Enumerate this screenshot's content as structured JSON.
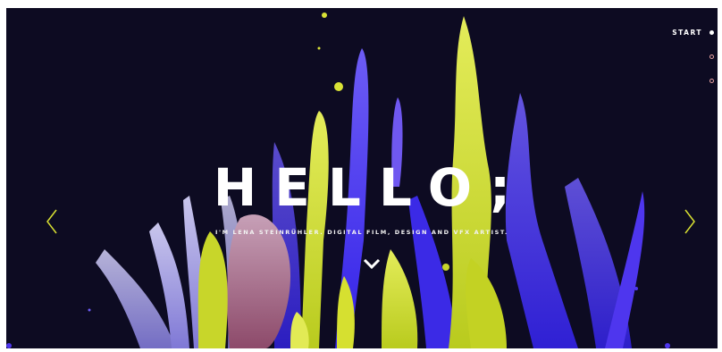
{
  "hero": {
    "title": "HELLO;",
    "subtitle": "I'M LENA STEINRÜHLER. DIGITAL FILM, DESIGN AND VFX ARTIST."
  },
  "nav": {
    "items": [
      {
        "label": "START",
        "active": true
      },
      {
        "label": "",
        "active": false
      },
      {
        "label": "",
        "active": false
      }
    ]
  },
  "icons": {
    "prev": "chevron-left-icon",
    "next": "chevron-right-icon",
    "scroll": "chevron-down-icon"
  },
  "colors": {
    "background": "#0d0b22",
    "accent_yellow": "#d8e032",
    "accent_blue": "#4a3df0",
    "nav_dot": "#e9a4a4",
    "text": "#ffffff"
  }
}
